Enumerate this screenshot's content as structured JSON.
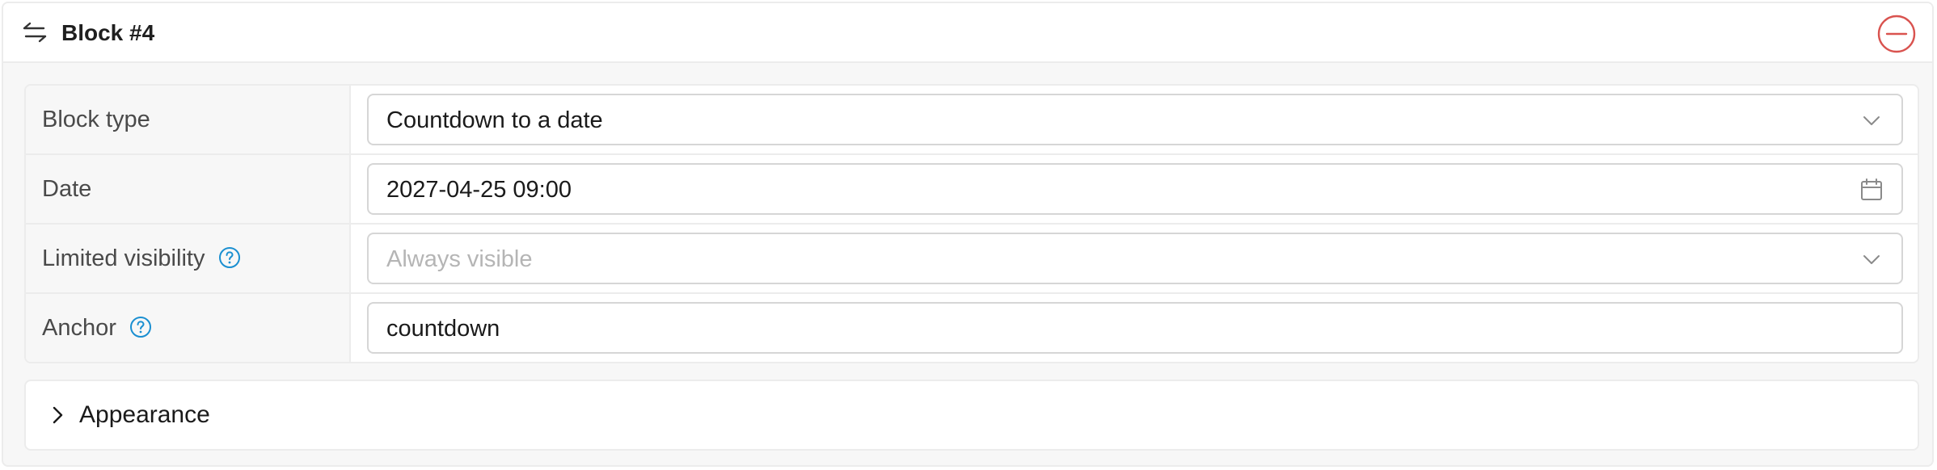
{
  "block": {
    "title": "Block #4",
    "icons": {
      "drag": "swap-arrows-icon",
      "remove": "minus-circle-icon"
    },
    "colors": {
      "remove": "#d9534f",
      "help": "#1a8fd1"
    }
  },
  "fields": {
    "block_type": {
      "label": "Block type",
      "value": "Countdown to a date",
      "icon": "chevron-down-icon"
    },
    "date": {
      "label": "Date",
      "value": "2027-04-25 09:00",
      "icon": "calendar-icon"
    },
    "limited_visibility": {
      "label": "Limited visibility",
      "placeholder": "Always visible",
      "icon": "chevron-down-icon"
    },
    "anchor": {
      "label": "Anchor",
      "value": "countdown"
    }
  },
  "appearance": {
    "label": "Appearance"
  }
}
